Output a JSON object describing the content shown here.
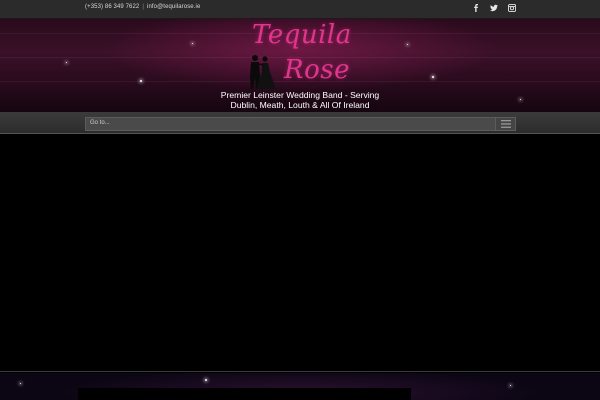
{
  "topbar": {
    "phone": "(+353) 86 349 7622",
    "separator": "|",
    "email": "info@tequilarose.ie",
    "social": [
      "facebook-icon",
      "twitter-icon",
      "instagram-icon"
    ]
  },
  "header": {
    "logo_line1": "Tequila",
    "logo_line2": "Rose",
    "tagline_line1": "Premier Leinster Wedding Band - Serving",
    "tagline_line2": "Dublin, Meath, Louth & All Of Ireland"
  },
  "nav": {
    "select_text": "Go to..."
  },
  "colors": {
    "brand_pink": "#e0348e",
    "topbar_bg": "#2b2b2b",
    "nav_bg": "#3a3a3a",
    "main_bg": "#000000"
  }
}
